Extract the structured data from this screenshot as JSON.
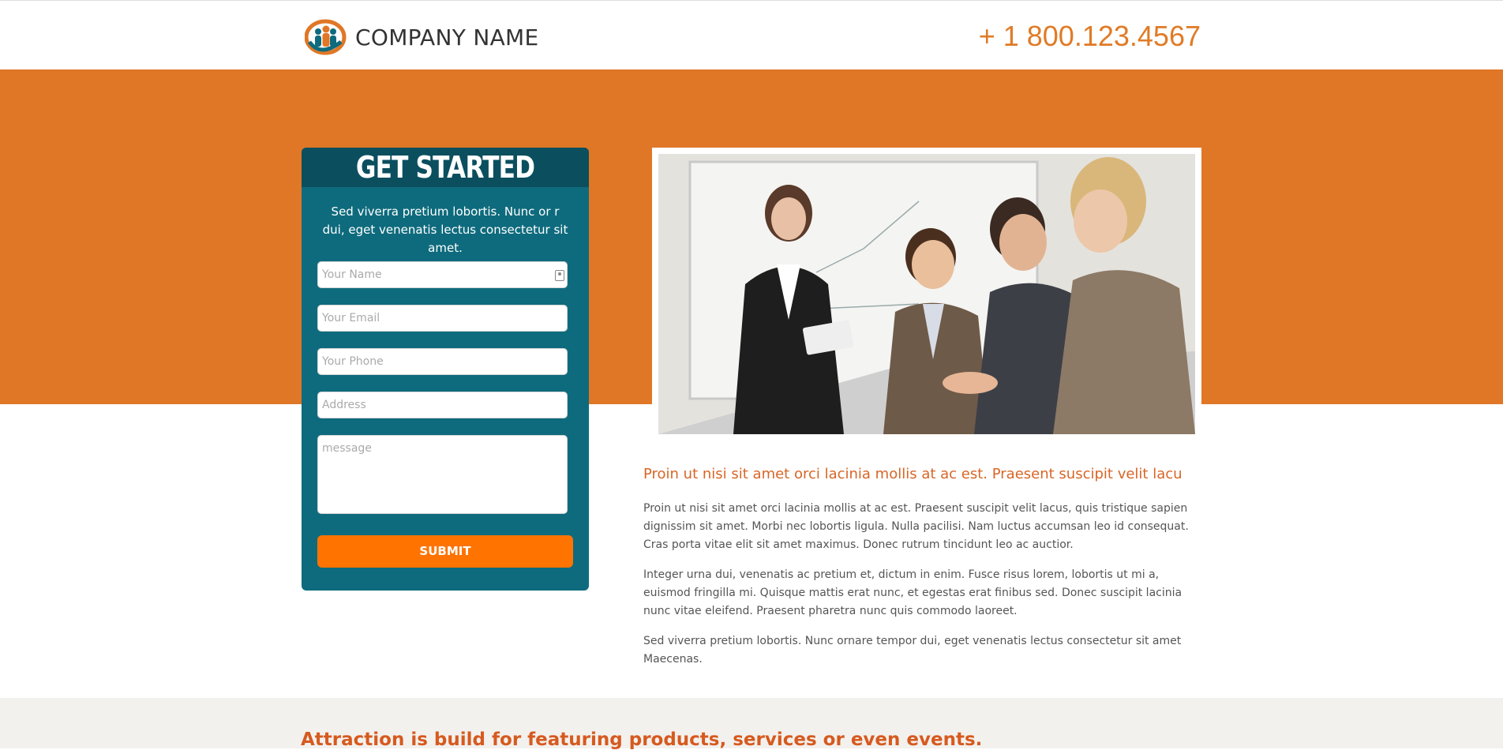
{
  "header": {
    "company_name": "COMPANY NAME",
    "phone": "+ 1 800.123.4567"
  },
  "form": {
    "title": "GET STARTED",
    "description": "Sed viverra pretium lobortis. Nunc or r dui, eget venenatis lectus consectetur sit amet.",
    "name_placeholder": "Your Name",
    "email_placeholder": "Your Email",
    "phone_placeholder": "Your Phone",
    "address_placeholder": "Address",
    "message_placeholder": "message",
    "submit_label": "SUBMIT"
  },
  "content": {
    "subheading": "Proin ut nisi sit amet orci lacinia mollis at ac est. Praesent suscipit velit lacu",
    "paragraph1": "Proin ut nisi sit amet orci lacinia mollis at ac est. Praesent suscipit velit lacus, quis tristique sapien dignissim sit amet. Morbi nec lobortis ligula. Nulla pacilisi. Nam luctus accumsan leo id consequat. Cras porta vitae elit sit amet maximus. Donec rutrum tincidunt leo ac auctior.",
    "paragraph2": "Integer urna dui, venenatis ac pretium et, dictum in enim. Fusce risus lorem, lobortis ut mi a, euismod fringilla mi. Quisque mattis erat nunc, et egestas erat finibus sed. Donec suscipit lacinia nunc vitae eleifend. Praesent pharetra nunc quis commodo laoreet.",
    "paragraph3": "Sed viverra pretium lobortis. Nunc ornare tempor dui, eget venenatis lectus consectetur sit amet Maecenas."
  },
  "feature": {
    "headline": "Attraction is build for featuring products, services or even events."
  },
  "colors": {
    "orange_band": "#e07726",
    "teal_card": "#0e6b7d",
    "teal_head": "#0b4f5f",
    "submit": "#ff7300",
    "accent_text": "#d86526"
  },
  "icons": {
    "logo": "company-logo-icon",
    "name_field": "contact-card-icon"
  }
}
